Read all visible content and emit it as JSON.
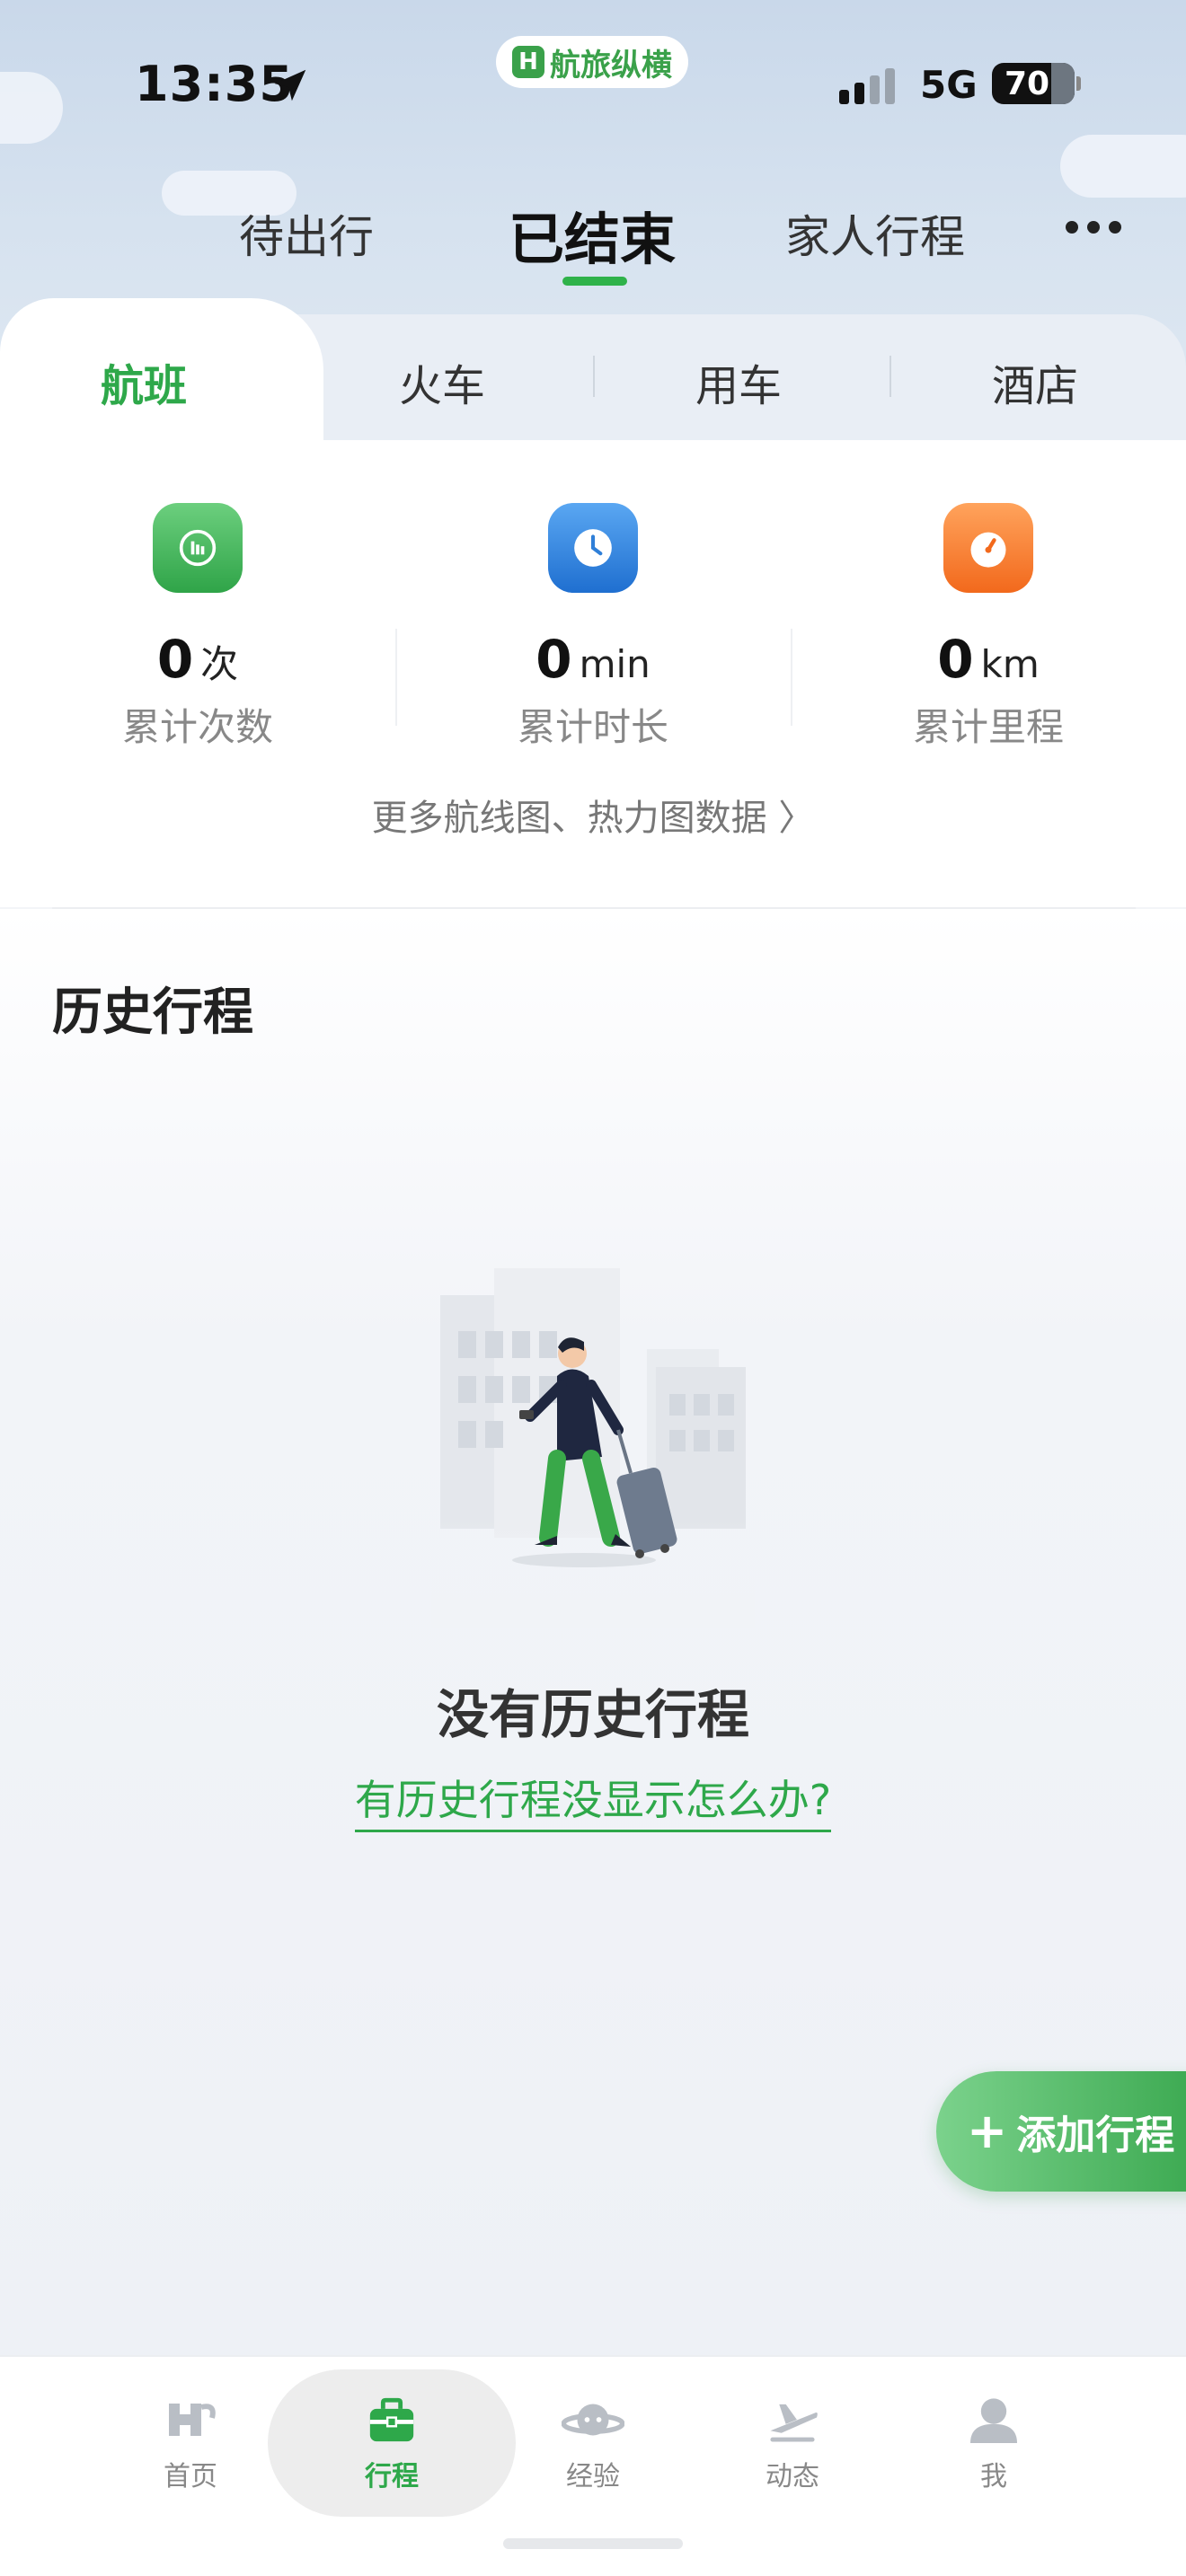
{
  "status_bar": {
    "time": "13:35",
    "network": "5G",
    "battery": "70"
  },
  "app_badge": {
    "name": "航旅纵横",
    "logo_glyph": "H"
  },
  "top_tabs": [
    {
      "label": "待出行"
    },
    {
      "label": "已结束",
      "active": true
    },
    {
      "label": "家人行程"
    }
  ],
  "category_tabs": [
    {
      "label": "航班",
      "active": true
    },
    {
      "label": "火车"
    },
    {
      "label": "用车"
    },
    {
      "label": "酒店"
    }
  ],
  "stats": [
    {
      "value": "0",
      "unit": "次",
      "label": "累计次数",
      "icon": "chart-icon",
      "color": "#3aaa55"
    },
    {
      "value": "0",
      "unit": "min",
      "label": "累计时长",
      "icon": "clock-icon",
      "color": "#2f7fd8"
    },
    {
      "value": "0",
      "unit": "km",
      "label": "累计里程",
      "icon": "speedometer-icon",
      "color": "#f57a22"
    }
  ],
  "more_link": "更多航线图、热力图数据 〉",
  "history": {
    "title": "历史行程",
    "empty_text": "没有历史行程",
    "help_link": "有历史行程没显示怎么办?"
  },
  "fab": {
    "label": "添加行程",
    "icon": "plus-icon"
  },
  "bottom_nav": [
    {
      "label": "首页",
      "icon": "home-logo-icon"
    },
    {
      "label": "行程",
      "icon": "briefcase-icon",
      "active": true
    },
    {
      "label": "经验",
      "icon": "planet-icon"
    },
    {
      "label": "动态",
      "icon": "plane-takeoff-icon"
    },
    {
      "label": "我",
      "icon": "user-icon"
    }
  ],
  "colors": {
    "accent": "#2ea84a",
    "sky": "#c9d8ea"
  }
}
